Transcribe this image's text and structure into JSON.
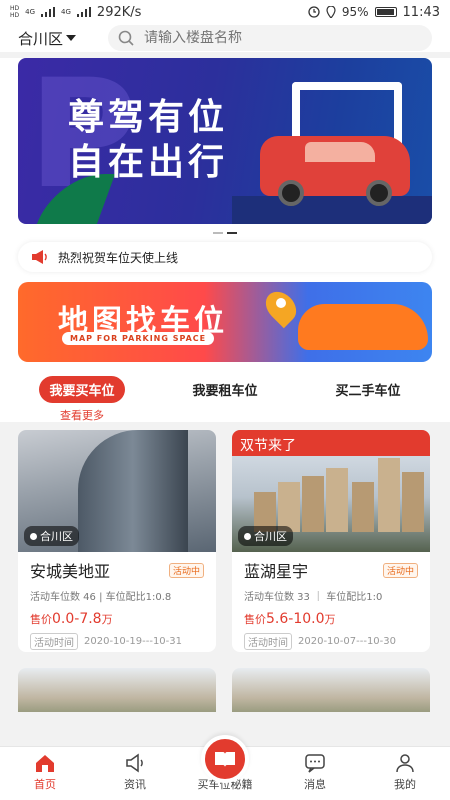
{
  "status_bar": {
    "network_top": "HD",
    "network_bottom": "HD",
    "signal1": "4G",
    "signal2": "4G",
    "speed": "292K/s",
    "battery": "95%",
    "battery_level": 0.95,
    "time": "11:43"
  },
  "header": {
    "city": "合川区",
    "search_placeholder": "请输入楼盘名称"
  },
  "banner": {
    "line1": "尊驾有位",
    "line2": "自在出行",
    "page_index": 2,
    "page_count": 2
  },
  "notice": {
    "text": "热烈祝贺车位天使上线"
  },
  "map_banner": {
    "title": "地图找车位",
    "subtitle": "MAP FOR PARKING SPACE"
  },
  "tabs": [
    {
      "label": "我要买车位",
      "active": true
    },
    {
      "label": "我要租车位",
      "active": false
    },
    {
      "label": "买二手车位",
      "active": false
    }
  ],
  "see_more": "查看更多",
  "listings": [
    {
      "location": "合川区",
      "name": "安城美地亚",
      "status": "活动中",
      "meta": "活动车位数 46 | 车位配比1:0.8",
      "price_label": "售价",
      "price": "0.0-7.8",
      "price_unit": "万",
      "date_label": "活动时间",
      "date": "2020-10-19---10-31",
      "ribbon": ""
    },
    {
      "location": "合川区",
      "name": "蓝湖星宇",
      "status": "活动中",
      "meta": "活动车位数 33 ｜ 车位配比1:0",
      "price_label": "售价",
      "price": "5.6-10.0",
      "price_unit": "万",
      "date_label": "活动时间",
      "date": "2020-10-07---10-30",
      "ribbon": "双节来了"
    }
  ],
  "bottom_nav": [
    {
      "label": "首页",
      "icon": "home-icon",
      "active": true
    },
    {
      "label": "资讯",
      "icon": "speaker-icon",
      "active": false
    },
    {
      "label": "买车位秘籍",
      "icon": "book-icon",
      "active": false
    },
    {
      "label": "消息",
      "icon": "message-icon",
      "active": false
    },
    {
      "label": "我的",
      "icon": "user-icon",
      "active": false
    }
  ],
  "colors": {
    "accent": "#e23b2e",
    "badge": "#e86a1a"
  }
}
